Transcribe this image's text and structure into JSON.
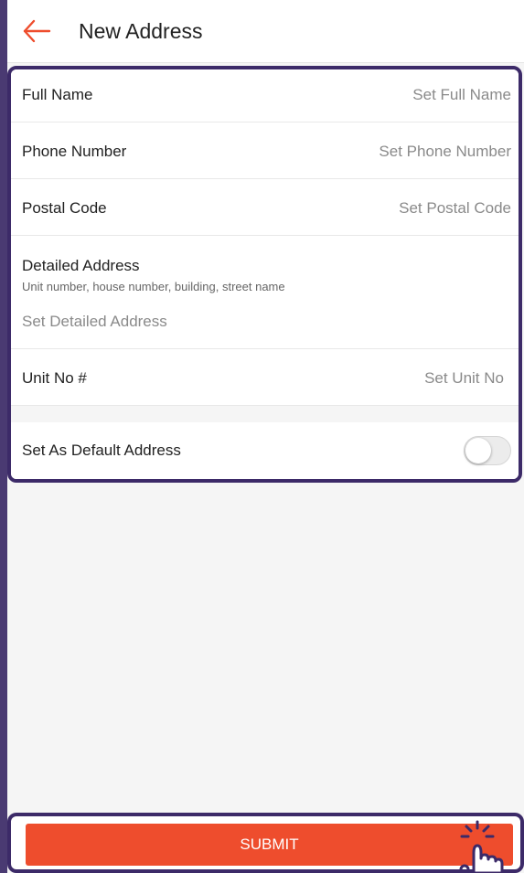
{
  "header": {
    "title": "New Address",
    "back_icon": "arrow-left-icon"
  },
  "form": {
    "full_name": {
      "label": "Full Name",
      "placeholder": "Set Full Name"
    },
    "phone_number": {
      "label": "Phone Number",
      "placeholder": "Set Phone Number"
    },
    "postal_code": {
      "label": "Postal Code",
      "placeholder": "Set Postal Code"
    },
    "detailed_address": {
      "label": "Detailed Address",
      "hint": "Unit number, house number, building, street name",
      "placeholder": "Set Detailed Address"
    },
    "unit_no": {
      "label": "Unit No #",
      "placeholder": "Set Unit No"
    },
    "default_address": {
      "label": "Set As Default Address",
      "enabled": false
    }
  },
  "footer": {
    "submit_label": "SUBMIT"
  },
  "colors": {
    "accent": "#ee4d2d",
    "highlight_frame": "#3c2a68"
  }
}
